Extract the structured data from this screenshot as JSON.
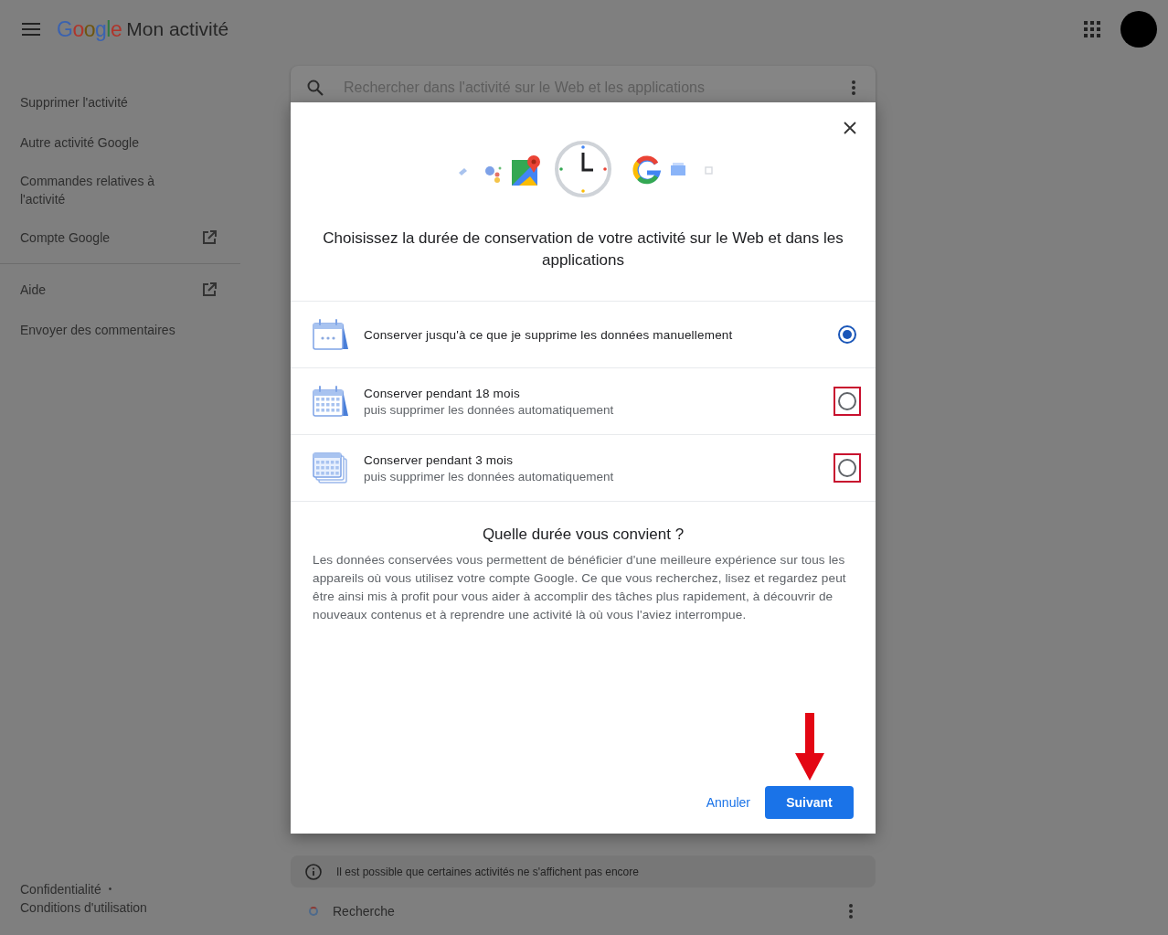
{
  "header": {
    "logo": "Google",
    "title": "Mon activité"
  },
  "sidebar": {
    "items": [
      {
        "label": "Supprimer l'activité",
        "external": false
      },
      {
        "label": "Autre activité Google",
        "external": false
      },
      {
        "label": "Commandes relatives à l'activité",
        "external": false
      },
      {
        "label": "Compte Google",
        "external": true
      }
    ],
    "secondary_items": [
      {
        "label": "Aide",
        "external": true
      },
      {
        "label": "Envoyer des commentaires",
        "external": false
      }
    ],
    "footer": {
      "privacy": "Confidentialité",
      "separator": "•",
      "terms": "Conditions d'utilisation"
    }
  },
  "search": {
    "placeholder": "Rechercher dans l'activité sur le Web et les applications"
  },
  "dialog": {
    "title": "Choisissez la durée de conservation de votre activité sur le Web et dans les applications",
    "options": [
      {
        "kind": "manual",
        "label": "Conserver jusqu'à ce que je supprime les données manuellement",
        "selected": true,
        "highlighted": false
      },
      {
        "kind": "months18",
        "label": "Conserver pendant 18 mois",
        "sublabel": "puis supprimer les données automatiquement",
        "selected": false,
        "highlighted": true
      },
      {
        "kind": "months3",
        "label": "Conserver pendant 3 mois",
        "sublabel": "puis supprimer les données automatiquement",
        "selected": false,
        "highlighted": true
      }
    ],
    "question": "Quelle durée vous convient ?",
    "body": "Les données conservées vous permettent de bénéficier d'une meilleure expérience sur tous les appareils où vous utilisez votre compte Google. Ce que vous recherchez, lisez et regardez peut être ainsi mis à profit pour vous aider à accomplir des tâches plus rapidement, à découvrir de nouveaux contenus et à reprendre une activité là où vous l'aviez interrompue.",
    "cancel": "Annuler",
    "next": "Suivant"
  },
  "notice": "Il est possible que certaines activités ne s'affichent pas encore",
  "result": {
    "label": "Recherche"
  }
}
